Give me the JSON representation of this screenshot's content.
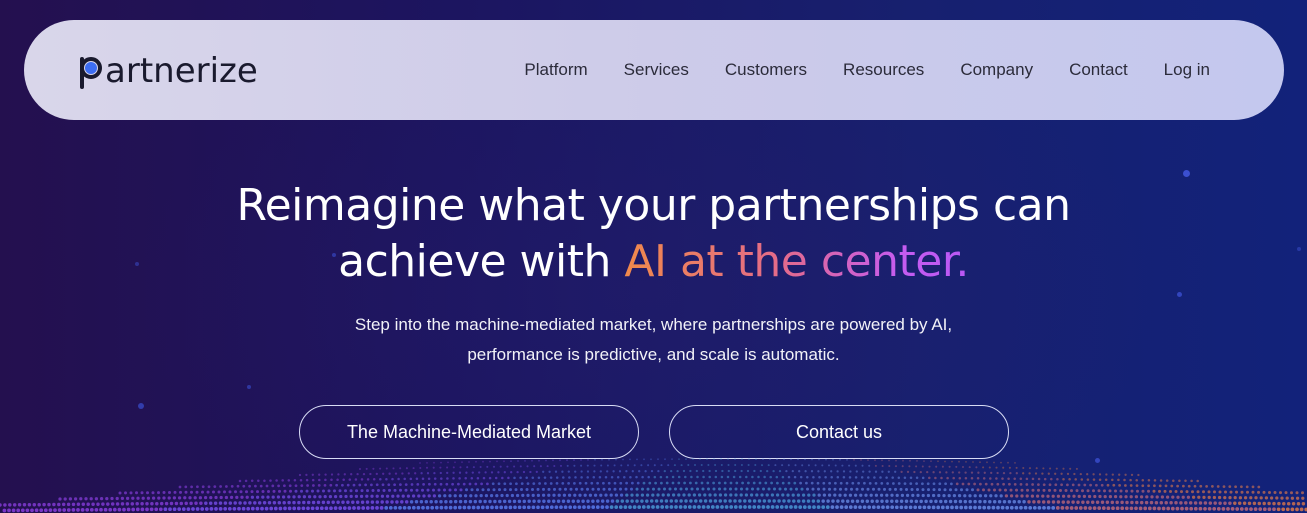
{
  "brand": {
    "logo_text": "artnerize",
    "logo_accent_color": "#3d6df2"
  },
  "nav": {
    "items": [
      {
        "label": "Platform"
      },
      {
        "label": "Services"
      },
      {
        "label": "Customers"
      },
      {
        "label": "Resources"
      },
      {
        "label": "Company"
      },
      {
        "label": "Contact"
      },
      {
        "label": "Log in"
      }
    ]
  },
  "hero": {
    "headline_line1": "Reimagine what your partnerships can",
    "headline_line2_plain": "achieve with ",
    "headline_line2_highlight": "AI at the center.",
    "subtext_line1": "Step into the machine-mediated market, where partnerships are powered by AI,",
    "subtext_line2": "performance is predictive, and scale is automatic.",
    "highlight_gradient": [
      "#f08a4b",
      "#e36b8a",
      "#c55cf0"
    ]
  },
  "cta": {
    "primary_label": "The Machine-Mediated Market",
    "secondary_label": "Contact us"
  },
  "theme": {
    "background_start": "#24104f",
    "background_end": "#12227a",
    "nav_background": "#d0cee9"
  }
}
